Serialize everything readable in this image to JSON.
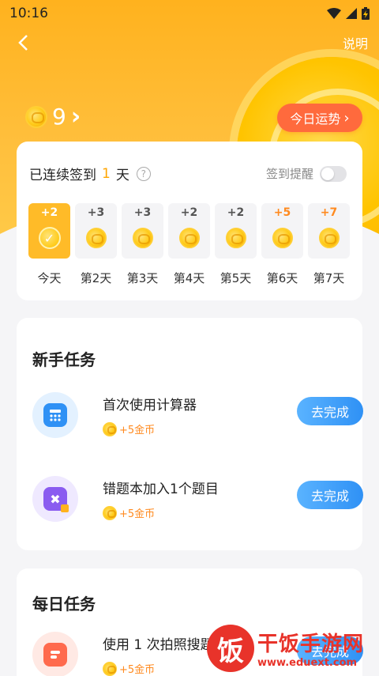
{
  "status_bar": {
    "time": "10:16",
    "battery_icon": "battery-charging-icon"
  },
  "nav": {
    "back_icon": "back-arrow-icon",
    "explain_label": "说明"
  },
  "balance": {
    "value": "9",
    "chevron": "›"
  },
  "fortune_button": {
    "label": "今日运势",
    "chevron": "›"
  },
  "signin": {
    "prefix": "已连续签到",
    "days": "1",
    "suffix": "天",
    "help": "?",
    "reminder_label": "签到提醒",
    "reminder_enabled": false,
    "days_list": [
      {
        "label": "今天",
        "points": "+2",
        "today": true
      },
      {
        "label": "第2天",
        "points": "+3"
      },
      {
        "label": "第3天",
        "points": "+3"
      },
      {
        "label": "第4天",
        "points": "+2"
      },
      {
        "label": "第5天",
        "points": "+2"
      },
      {
        "label": "第6天",
        "points": "+5",
        "highlight": true
      },
      {
        "label": "第7天",
        "points": "+7",
        "highlight": true
      }
    ]
  },
  "new_tasks": {
    "title": "新手任务",
    "items": [
      {
        "name": "首次使用计算器",
        "reward": "+5金币",
        "button": "去完成",
        "icon": "calculator-icon"
      },
      {
        "name": "错题本加入1个题目",
        "reward": "+5金币",
        "button": "去完成",
        "icon": "wrong-book-icon"
      }
    ]
  },
  "daily_tasks": {
    "title": "每日任务",
    "items": [
      {
        "name": "使用 1 次拍照搜题",
        "reward": "+5金币",
        "button": "去完成",
        "icon": "photo-search-icon"
      }
    ]
  },
  "watermark": {
    "name": "干饭手游网",
    "url": "www.eduext.com",
    "logo_char": "饭"
  },
  "colors": {
    "accent": "#ffb21e",
    "button_blue": "#2f91f5",
    "fortune": "#ff6a3d",
    "reward": "#ff8a1f"
  }
}
